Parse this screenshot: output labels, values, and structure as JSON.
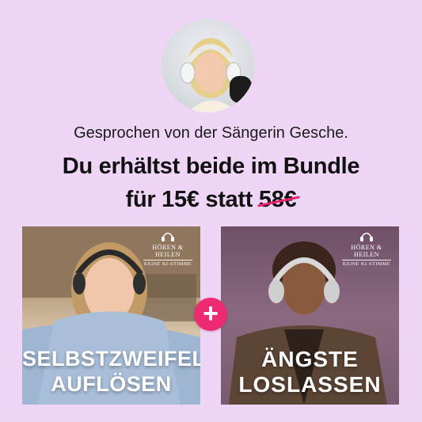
{
  "colors": {
    "background": "#f0d6f6",
    "accent": "#ee2a73",
    "strike": "#e8236a"
  },
  "speaker_caption": "Gesprochen von der Sängerin Gesche.",
  "headline": {
    "line1": "Du erhältst beide im Bundle",
    "line2_prefix": "für 15€ statt",
    "old_price": "58€"
  },
  "brand": {
    "name": "HÖREN & HEILEN",
    "tagline": "KEINE KI-STIMME"
  },
  "cards": [
    {
      "title_line1": "SELBSTZWEIFEL",
      "title_line2": "AUFLÖSEN"
    },
    {
      "title_line1": "ÄNGSTE",
      "title_line2": "LOSLASSEN"
    }
  ],
  "plus_symbol": "+"
}
